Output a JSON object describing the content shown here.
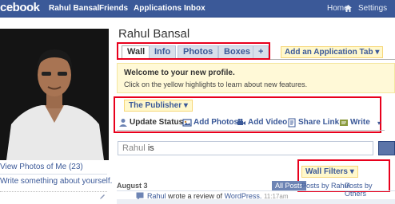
{
  "topbar": {
    "logo": "cebook",
    "nav": [
      "Rahul Bansal",
      "Friends",
      "Applications",
      "Inbox"
    ],
    "home_label": "Home",
    "settings_label": "Settings"
  },
  "left": {
    "view_photos": "View Photos of Me (23)",
    "write_about": "Write something about yourself."
  },
  "profile": {
    "name": "Rahul Bansal",
    "tabs": [
      "Wall",
      "Info",
      "Photos",
      "Boxes",
      "+"
    ],
    "add_app_tab": "Add an Application Tab"
  },
  "welcome": {
    "title": "Welcome to your new profile.",
    "text": "Click on the yellow highlights to learn about new features."
  },
  "publisher": {
    "label": "The Publisher",
    "actions": [
      "Update Status",
      "Add Photos",
      "Add Video",
      "Share Link",
      "Write"
    ]
  },
  "status_input": {
    "name": "Rahul",
    "verb": "is"
  },
  "wall_filters": {
    "label": "Wall Filters",
    "all_posts": "All Posts",
    "posts_by_rahul": "Posts by Rahul",
    "posts_by_others": "Posts by Others"
  },
  "feed": {
    "date": "August 3",
    "story_name": "Rahul",
    "story_text": "wrote a review of",
    "story_link": "WordPress.",
    "story_time": "11:17am"
  },
  "colors": {
    "brand_blue": "#3b5998",
    "highlight_red": "#e8001c",
    "yellow_highlight": "#fff9d7"
  }
}
